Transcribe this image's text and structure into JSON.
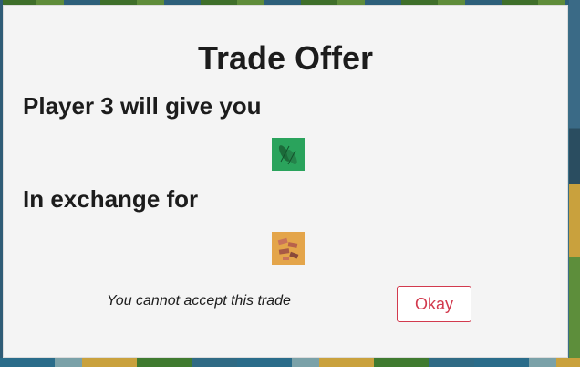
{
  "modal": {
    "title": "Trade Offer",
    "give_heading": "Player 3 will give you",
    "give_resource_icon": "wood-icon",
    "exchange_heading": "In exchange for",
    "exchange_resource_icon": "brick-icon",
    "notice": "You cannot accept this trade",
    "okay_label": "Okay"
  },
  "colors": {
    "button_accent": "#d23a4e",
    "wood_tile": "#2aa35c",
    "brick_tile": "#e4a54a"
  }
}
